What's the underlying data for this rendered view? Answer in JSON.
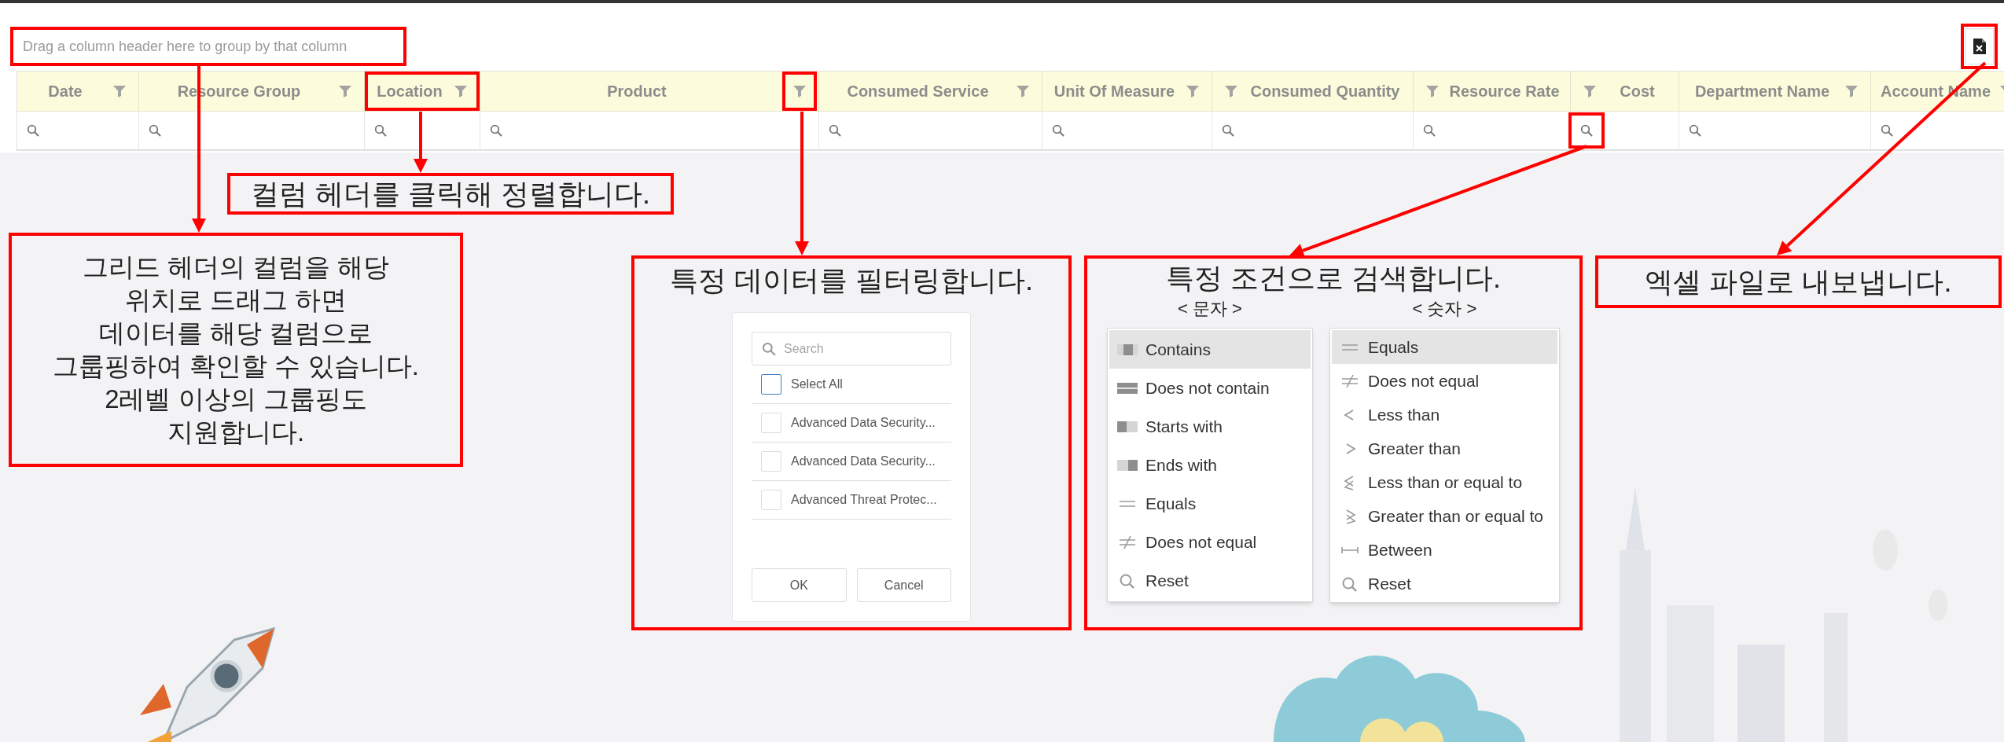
{
  "group_panel": {
    "text": "Drag a column header here to group by that column",
    "marked": true
  },
  "export_button": {
    "marked": true
  },
  "grid": {
    "columns": [
      {
        "label": "Date",
        "kind": "text",
        "header_marked": false,
        "filter_icon_marked": false,
        "search_marked": false
      },
      {
        "label": "Resource Group",
        "kind": "text",
        "header_marked": false,
        "filter_icon_marked": false,
        "search_marked": false
      },
      {
        "label": "Location",
        "kind": "text",
        "header_marked": true,
        "filter_icon_marked": false,
        "search_marked": false
      },
      {
        "label": "Product",
        "kind": "text",
        "header_marked": false,
        "filter_icon_marked": true,
        "search_marked": false
      },
      {
        "label": "Consumed Service",
        "kind": "text",
        "header_marked": false,
        "filter_icon_marked": false,
        "search_marked": false
      },
      {
        "label": "Unit Of Measure",
        "kind": "text",
        "header_marked": false,
        "filter_icon_marked": false,
        "search_marked": false
      },
      {
        "label": "Consumed Quantity",
        "kind": "number",
        "header_marked": false,
        "filter_icon_marked": false,
        "search_marked": false
      },
      {
        "label": "Resource Rate",
        "kind": "number",
        "header_marked": false,
        "filter_icon_marked": false,
        "search_marked": false
      },
      {
        "label": "Cost",
        "kind": "number",
        "header_marked": false,
        "filter_icon_marked": false,
        "search_marked": true
      },
      {
        "label": "Department Name",
        "kind": "text",
        "header_marked": false,
        "filter_icon_marked": false,
        "search_marked": false
      },
      {
        "label": "Account Name",
        "kind": "text",
        "header_marked": false,
        "filter_icon_marked": false,
        "search_marked": false
      }
    ]
  },
  "callouts": {
    "sort": {
      "text": "컬럼 헤더를 클릭해 정렬합니다."
    },
    "group": {
      "lines": [
        "그리드 헤더의 컬럼을 해당",
        "위치로 드래그 하면",
        "데이터를 해당 컬럼으로",
        "그룹핑하여 확인할 수 있습니다.",
        "2레벨 이상의 그룹핑도",
        "지원합니다."
      ]
    },
    "filter": {
      "title": "특정 데이터를 필터링합니다."
    },
    "search": {
      "title": "특정 조건으로 검색합니다."
    },
    "export": {
      "text": "엑셀 파일로 내보냅니다."
    }
  },
  "filter_popup": {
    "placeholder": "Search",
    "items": [
      {
        "label": "Select All",
        "kind": "all",
        "checked": false
      },
      {
        "label": "Advanced Data Security...",
        "kind": "value",
        "checked": false
      },
      {
        "label": "Advanced Data Security...",
        "kind": "value",
        "checked": false
      },
      {
        "label": "Advanced Threat Protec...",
        "kind": "value",
        "checked": false
      }
    ],
    "buttons": [
      "OK",
      "Cancel"
    ]
  },
  "text_conditions": {
    "heading": "< 문자 >",
    "items": [
      {
        "label": "Contains",
        "kind": "contains",
        "selected": true
      },
      {
        "label": "Does not contain",
        "kind": "not_contains",
        "selected": false
      },
      {
        "label": "Starts with",
        "kind": "starts_with",
        "selected": false
      },
      {
        "label": "Ends with",
        "kind": "ends_with",
        "selected": false
      },
      {
        "label": "Equals",
        "kind": "equals",
        "selected": false
      },
      {
        "label": "Does not equal",
        "kind": "not_equal",
        "selected": false
      },
      {
        "label": "Reset",
        "kind": "reset",
        "selected": false
      }
    ]
  },
  "number_conditions": {
    "heading": "< 숫자 >",
    "items": [
      {
        "label": "Equals",
        "kind": "equals",
        "selected": true
      },
      {
        "label": "Does not equal",
        "kind": "not_equal",
        "selected": false
      },
      {
        "label": "Less than",
        "kind": "less",
        "selected": false
      },
      {
        "label": "Greater than",
        "kind": "greater",
        "selected": false
      },
      {
        "label": "Less than or equal to",
        "kind": "less_equal",
        "selected": false
      },
      {
        "label": "Greater than or equal to",
        "kind": "greater_equal",
        "selected": false
      },
      {
        "label": "Between",
        "kind": "between",
        "selected": false
      },
      {
        "label": "Reset",
        "kind": "reset",
        "selected": false
      }
    ]
  }
}
